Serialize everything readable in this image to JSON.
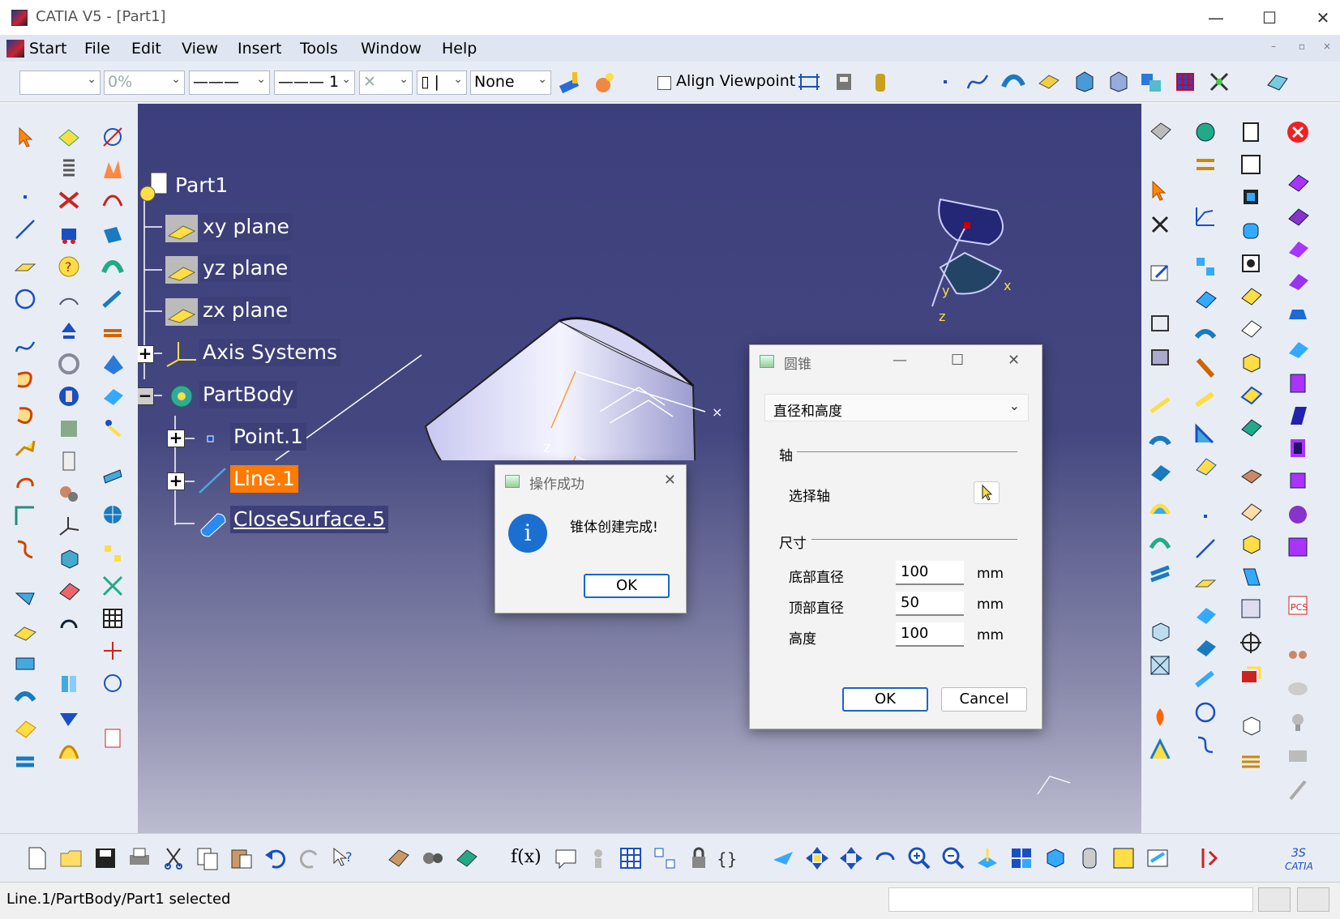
{
  "window": {
    "title": "CATIA V5 - [Part1]",
    "minimize": "—",
    "maximize": "☐",
    "close": "✕"
  },
  "menu": {
    "items": [
      "Start",
      "File",
      "Edit",
      "View",
      "Insert",
      "Tools",
      "Window",
      "Help"
    ]
  },
  "toolbar": {
    "color_combo": "",
    "transparency_combo": "0%",
    "linetype_combo": "———",
    "thickness_combo": "——— 1",
    "point_combo": "✕",
    "layer_prefix": "▯ |",
    "layer_combo": "None",
    "align_viewpoint_label": "Align Viewpoint"
  },
  "tree": {
    "root": "Part1",
    "nodes": [
      "xy plane",
      "yz plane",
      "zx plane",
      "Axis Systems",
      "PartBody",
      "Point.1",
      "Line.1",
      "CloseSurface.5"
    ],
    "expand_plus": "+",
    "expand_minus": "−"
  },
  "compass": {
    "x": "x",
    "y": "y",
    "z": "z"
  },
  "dialog_success": {
    "title": "操作成功",
    "message": "锥体创建完成!",
    "info_icon": "i",
    "ok": "OK",
    "close": "✕"
  },
  "dialog_cone": {
    "title": "圆锥",
    "mode": "直径和高度",
    "axis_section": "轴",
    "select_axis_label": "选择轴",
    "size_section": "尺寸",
    "fields": [
      {
        "label": "底部直径",
        "value": "100",
        "unit": "mm"
      },
      {
        "label": "顶部直径",
        "value": "50",
        "unit": "mm"
      },
      {
        "label": "高度",
        "value": "100",
        "unit": "mm"
      }
    ],
    "ok": "OK",
    "cancel": "Cancel",
    "minimize": "—",
    "maximize": "☐",
    "close": "✕"
  },
  "status": {
    "text": "Line.1/PartBody/Part1 selected"
  },
  "colors": {
    "viewport_top": "#3c3f7c",
    "selection": "#ff7a00",
    "primary_button": "#1a66c7"
  }
}
